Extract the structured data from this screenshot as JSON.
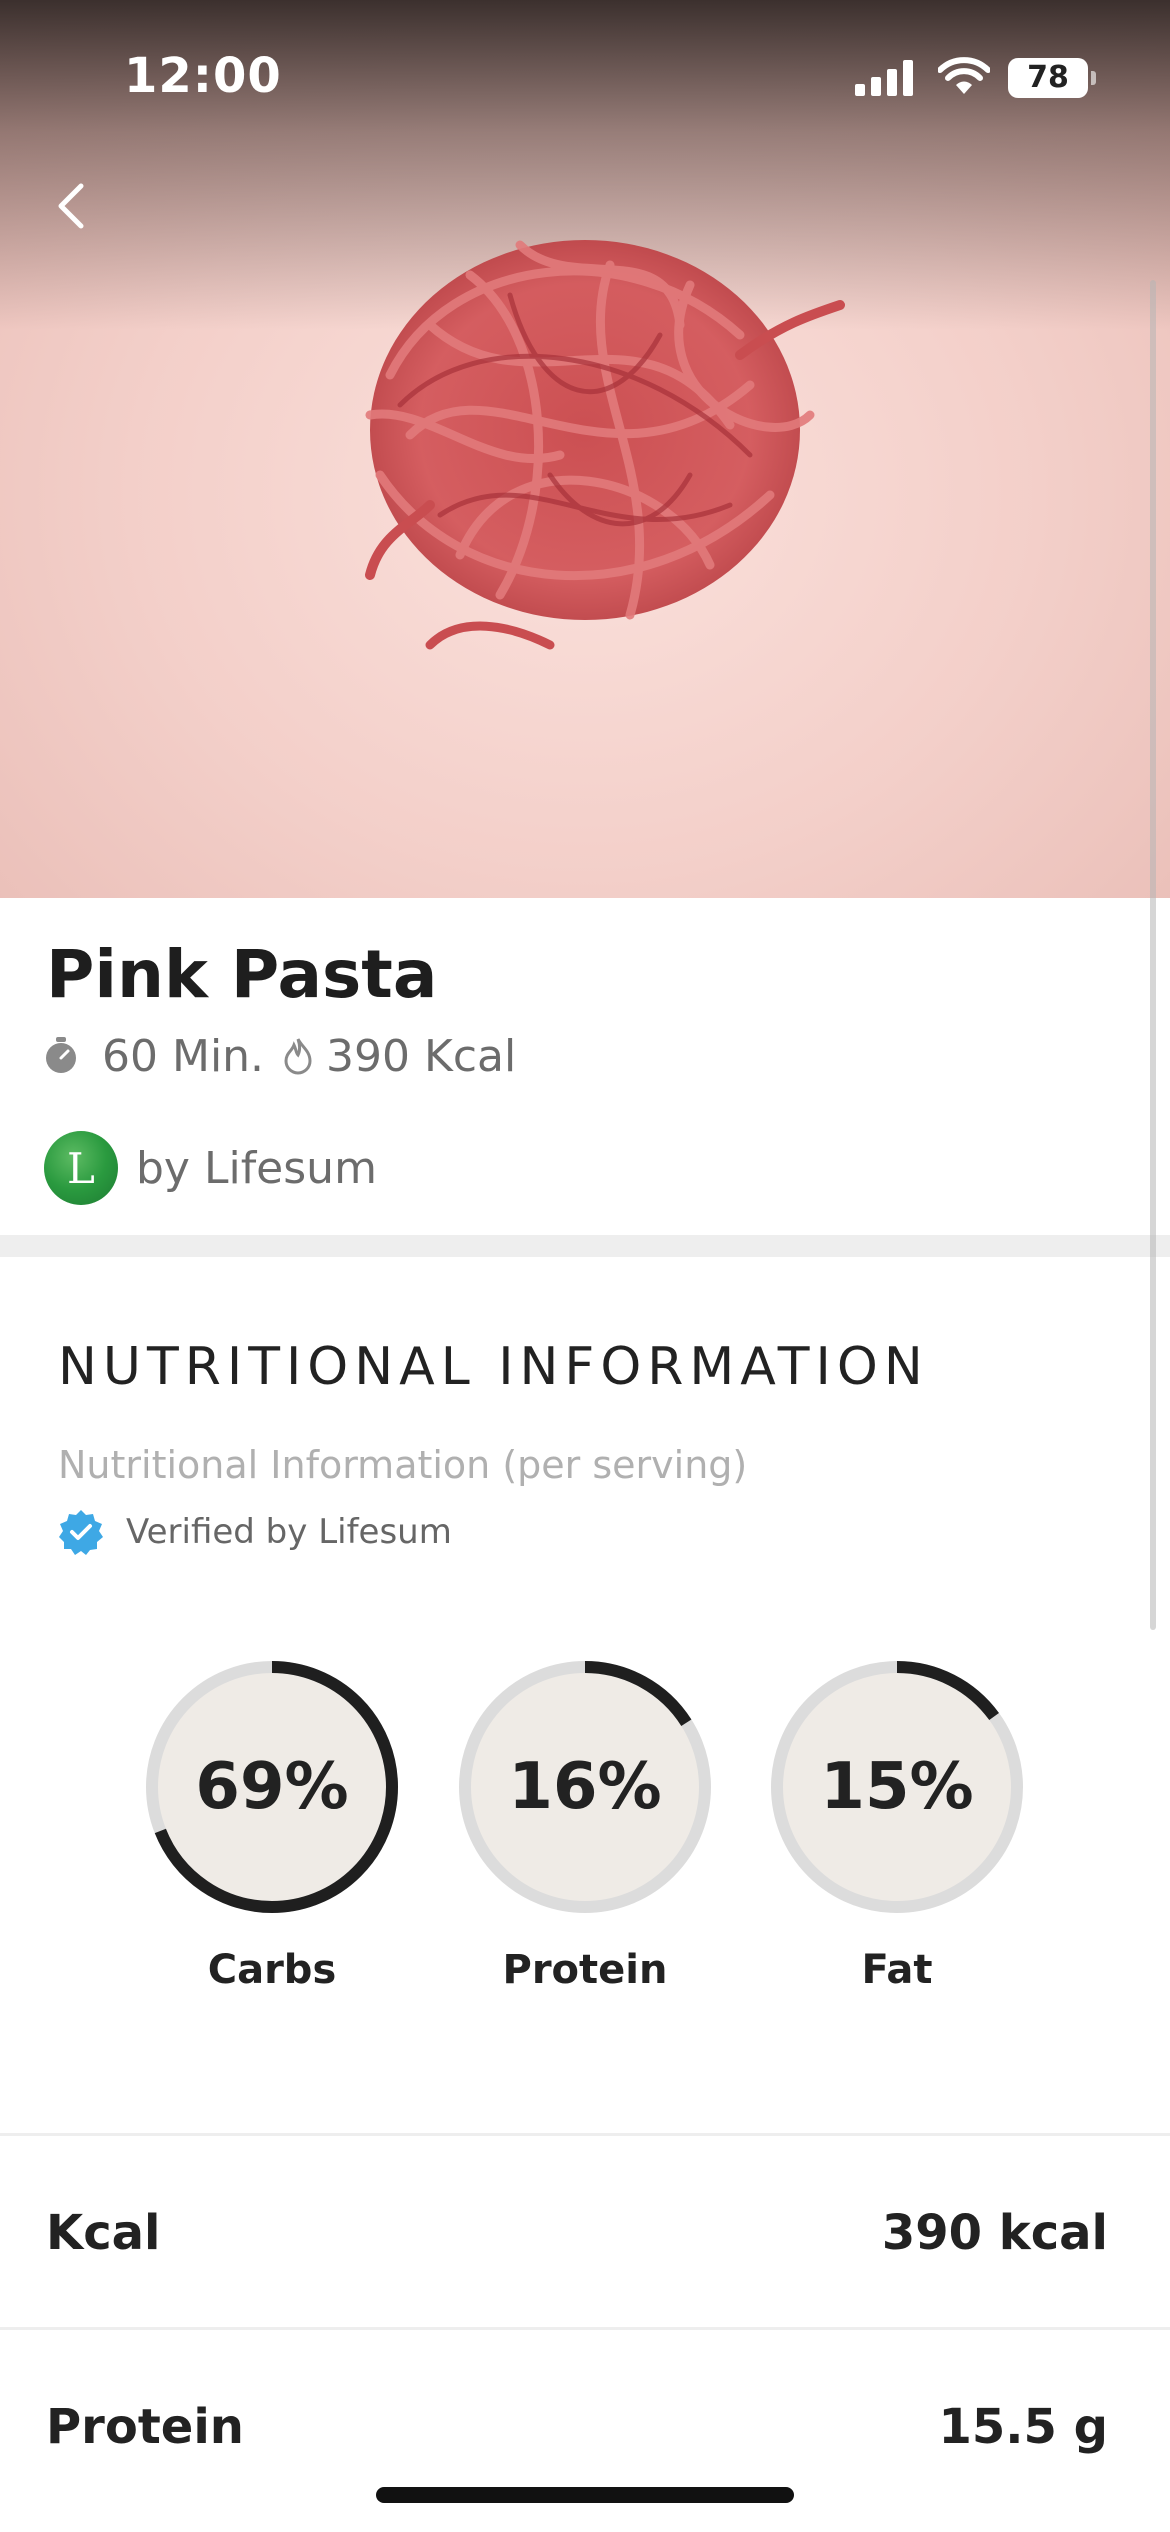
{
  "status_bar": {
    "time": "12:00",
    "battery": "78",
    "icons": [
      "signal-icon",
      "wifi-icon",
      "battery-icon"
    ]
  },
  "header": {
    "back_icon": "chevron-left-icon",
    "hero_image": "pink-pasta-photo"
  },
  "recipe": {
    "title": "Pink Pasta",
    "time": "60 Min.",
    "kcal": "390 Kcal",
    "time_icon": "timer-icon",
    "kcal_icon": "flame-icon",
    "author_initial": "L",
    "author": "by Lifesum"
  },
  "nutrition": {
    "heading": "NUTRITIONAL INFORMATION",
    "subheading": "Nutritional Information (per serving)",
    "verified": "Verified by Lifesum",
    "verified_icon": "verified-badge-icon",
    "macros": [
      {
        "label": "Carbs",
        "value": "69%",
        "fraction": 0.69
      },
      {
        "label": "Protein",
        "value": "16%",
        "fraction": 0.16
      },
      {
        "label": "Fat",
        "value": "15%",
        "fraction": 0.15
      }
    ],
    "rows": [
      {
        "label": "Kcal",
        "value": "390 kcal"
      },
      {
        "label": "Protein",
        "value": "15.5 g"
      }
    ]
  },
  "colors": {
    "ring_track": "#dcdcdc",
    "ring_progress": "#1f1f1f",
    "ring_fill": "#efebe6",
    "verified_badge": "#3ea8e5",
    "avatar": "#2a9a3f"
  }
}
